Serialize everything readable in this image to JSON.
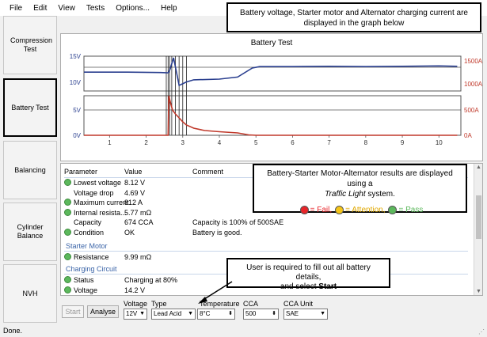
{
  "menu": [
    "File",
    "Edit",
    "View",
    "Tests",
    "Options...",
    "Help"
  ],
  "callouts": {
    "top_line1": "Battery voltage, Starter motor and Alternator charging current are",
    "top_line2": "displayed in the graph below",
    "results_line1": "Battery-Starter Motor-Alternator results are displayed using a",
    "results_line2a": "Traffic Light",
    "results_line2b": " system.",
    "fail_label": "= Fail,",
    "attention_label": "= Attention,",
    "pass_label": "= Pass",
    "fail_color": "#e8252a",
    "attention_color": "#f5c518",
    "pass_color": "#5cb85c",
    "user_line1": "User is required to fill out all battery details,",
    "user_line2a": "and select ",
    "user_line2b": "Start"
  },
  "sidebar": [
    {
      "label": "Compression Test",
      "active": false
    },
    {
      "label": "Battery Test",
      "active": true
    },
    {
      "label": "Balancing",
      "active": false
    },
    {
      "label": "Cylinder Balance",
      "active": false
    },
    {
      "label": "NVH",
      "active": false
    }
  ],
  "chart_data": {
    "type": "line",
    "title": "Battery Test",
    "x": [
      1,
      2,
      3,
      4,
      5,
      6,
      7,
      8,
      9,
      10
    ],
    "xlim": [
      0.3,
      10.6
    ],
    "left_ticks": [
      "15V",
      "10V",
      "5V",
      "0V"
    ],
    "right_ticks": [
      "1500A",
      "1000A",
      "500A",
      "0A"
    ],
    "y_left_lim": [
      0,
      15
    ],
    "y_right_lim": [
      0,
      1500
    ],
    "series": [
      {
        "color": "#2a3f8f",
        "axis": "left",
        "points": [
          [
            0.3,
            12.7
          ],
          [
            1.5,
            12.7
          ],
          [
            2.4,
            12.65
          ],
          [
            2.6,
            12.6
          ],
          [
            2.65,
            8.3
          ],
          [
            2.75,
            9.8
          ],
          [
            2.9,
            10.8
          ],
          [
            3.1,
            11.3
          ],
          [
            3.3,
            11.6
          ],
          [
            4.0,
            11.7
          ],
          [
            4.5,
            12.0
          ],
          [
            4.9,
            13.3
          ],
          [
            5.1,
            13.5
          ],
          [
            6.0,
            13.5
          ],
          [
            7.0,
            13.55
          ],
          [
            8.0,
            13.5
          ],
          [
            9.0,
            13.55
          ],
          [
            10.0,
            13.6
          ],
          [
            10.5,
            13.55
          ]
        ]
      },
      {
        "color": "#c0392b",
        "axis": "right",
        "points": [
          [
            0.3,
            0
          ],
          [
            2.6,
            0
          ],
          [
            2.62,
            810
          ],
          [
            2.66,
            420
          ],
          [
            2.72,
            320
          ],
          [
            2.8,
            270
          ],
          [
            2.9,
            220
          ],
          [
            3.0,
            170
          ],
          [
            3.1,
            130
          ],
          [
            3.3,
            90
          ],
          [
            3.6,
            60
          ],
          [
            4.0,
            45
          ],
          [
            4.5,
            30
          ],
          [
            4.8,
            5
          ],
          [
            5.0,
            0
          ],
          [
            10.5,
            0
          ]
        ]
      }
    ],
    "event_lines": [
      2.55,
      2.6,
      2.64,
      2.7,
      2.8,
      2.9,
      3.0,
      3.1
    ]
  },
  "results": {
    "headers": {
      "parameter": "Parameter",
      "value": "Value",
      "comment": "Comment"
    },
    "battery_rows": [
      {
        "param": "Lowest voltage",
        "value": "8.12 V",
        "comment": "",
        "status": "pass"
      },
      {
        "param": "Voltage drop",
        "value": "4.69 V",
        "comment": "",
        "status": "none"
      },
      {
        "param": "Maximum current",
        "value": "812 A",
        "comment": "",
        "status": "pass"
      },
      {
        "param": "Internal resista...",
        "value": "5.77 mΩ",
        "comment": "",
        "status": "pass"
      },
      {
        "param": "Capacity",
        "value": "674 CCA",
        "comment": "Capacity is 100% of 500SAE",
        "status": "none"
      },
      {
        "param": "Condition",
        "value": "OK",
        "comment": "Battery is good.",
        "status": "pass"
      }
    ],
    "starter_title": "Starter Motor",
    "starter_rows": [
      {
        "param": "Resistance",
        "value": "9.99 mΩ",
        "comment": "",
        "status": "pass"
      }
    ],
    "charging_title": "Charging Circuit",
    "charging_rows": [
      {
        "param": "Status",
        "value": "Charging at 80%",
        "comment": "",
        "status": "pass"
      },
      {
        "param": "Voltage",
        "value": "14.2 V",
        "comment": "",
        "status": "pass"
      }
    ]
  },
  "controls": {
    "start_label": "Start",
    "analyse_label": "Analyse",
    "voltage_label": "Voltage",
    "voltage_value": "12V",
    "type_label": "Type",
    "type_value": "Lead Acid",
    "temperature_label": "Temperature",
    "temperature_value": "8°C",
    "cca_label": "CCA",
    "cca_value": "500",
    "cca_unit_label": "CCA Unit",
    "cca_unit_value": "SAE"
  },
  "status_text": "Done."
}
